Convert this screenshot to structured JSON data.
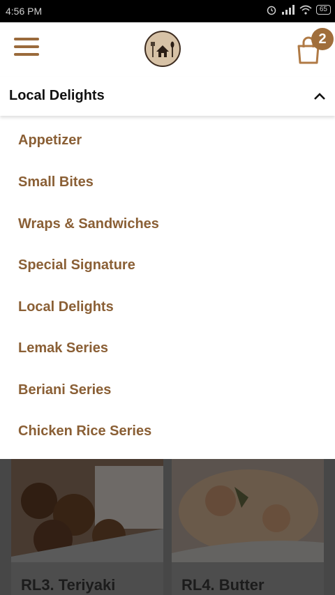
{
  "status_bar": {
    "time": "4:56 PM",
    "battery": "65"
  },
  "header": {
    "cart_count": "2"
  },
  "category": {
    "selected": "Local Delights",
    "items": [
      "Appetizer",
      "Small Bites",
      "Wraps & Sandwiches",
      "Special Signature",
      "Local Delights",
      "Lemak Series",
      "Beriani Series",
      "Chicken Rice Series"
    ]
  },
  "products": [
    {
      "name": "RL3. Teriyaki"
    },
    {
      "name": "RL4. Butter"
    }
  ],
  "colors": {
    "accent": "#8a5f35",
    "badge": "#a06e3b",
    "status_bar": "#000000"
  }
}
